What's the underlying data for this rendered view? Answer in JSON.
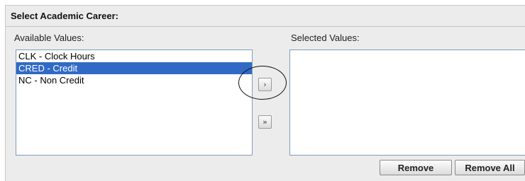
{
  "header": {
    "title": "Select Academic Career:"
  },
  "available": {
    "label": "Available Values:",
    "options": [
      {
        "text": "CLK - Clock Hours",
        "selected": false
      },
      {
        "text": "CRED - Credit",
        "selected": true
      },
      {
        "text": "NC - Non Credit",
        "selected": false
      }
    ]
  },
  "selected": {
    "label": "Selected Values:",
    "options": []
  },
  "move": {
    "add_one": "›",
    "add_all": "»"
  },
  "actions": {
    "remove": "Remove",
    "remove_all": "Remove All"
  },
  "colors": {
    "selection": "#316ac5",
    "panel": "#ececec",
    "list_border": "#7f9db9"
  }
}
